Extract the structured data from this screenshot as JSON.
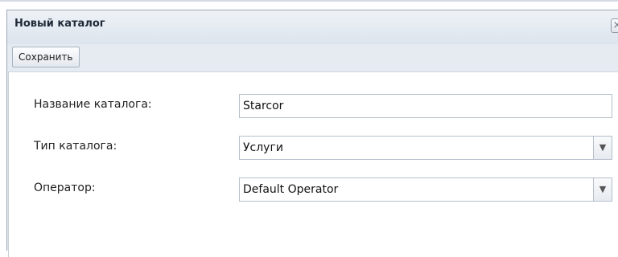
{
  "window": {
    "title": "Новый каталог",
    "close_glyph": "×"
  },
  "toolbar": {
    "save_label": "Сохранить"
  },
  "form": {
    "catalog_name": {
      "label": "Название каталога:",
      "value": "Starcor"
    },
    "catalog_type": {
      "label": "Тип каталога:",
      "value": "Услуги"
    },
    "operator": {
      "label": "Оператор:",
      "value": "Default Operator"
    }
  },
  "icons": {
    "close": "close-icon",
    "dropdown": "chevron-down-icon"
  }
}
